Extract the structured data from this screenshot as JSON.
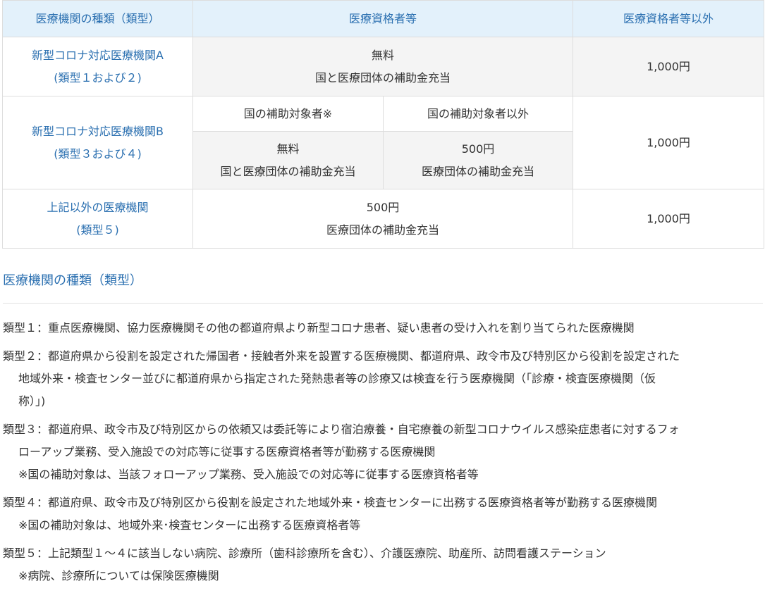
{
  "table": {
    "headers": [
      "医療機関の種類（類型）",
      "医療資格者等",
      "医療資格者等以外"
    ],
    "row_a": {
      "name": [
        "新型コロナ対応医療機関A",
        "(類型１および２)"
      ],
      "qualified": [
        "無料",
        "国と医療団体の補助金充当"
      ],
      "other": "1,000円"
    },
    "row_b": {
      "name": [
        "新型コロナ対応医療機関B",
        "(類型３および４)"
      ],
      "sub_headers": [
        "国の補助対象者※",
        "国の補助対象者以外"
      ],
      "subsidized": [
        "無料",
        "国と医療団体の補助金充当"
      ],
      "non_subsidized": [
        "500円",
        "医療団体の補助金充当"
      ],
      "other": "1,000円"
    },
    "row_c": {
      "name": [
        "上記以外の医療機関",
        "(類型５)"
      ],
      "qualified": [
        "500円",
        "医療団体の補助金充当"
      ],
      "other": "1,000円"
    }
  },
  "section_title": "医療機関の種類（類型）",
  "types": [
    {
      "main": "類型１：重点医療機関、協力医療機関その他の都道府県より新型コロナ患者、疑い患者の受け入れを割り当てられた医療機関",
      "cont": [],
      "notes": []
    },
    {
      "main": "類型２：都道府県から役割を設定された帰国者・接触者外来を設置する医療機関、都道府県、政令市及び特別区から役割を設定された",
      "cont": [
        "地域外来・検査センター並びに都道府県から指定された発熱患者等の診療又は検査を行う医療機関（「診療・検査医療機関（仮",
        "称）」)"
      ],
      "notes": []
    },
    {
      "main": "類型３：都道府県、政令市及び特別区からの依頼又は委託等により宿泊療養・自宅療養の新型コロナウイルス感染症患者に対するフォ",
      "cont": [
        "ローアップ業務、受入施設での対応等に従事する医療資格者等が勤務する医療機関"
      ],
      "notes": [
        "※国の補助対象は、当該フォローアップ業務、受入施設での対応等に従事する医療資格者等"
      ]
    },
    {
      "main": "類型４：都道府県、政令市及び特別区から役割を設定された地域外来・検査センターに出務する医療資格者等が勤務する医療機関",
      "cont": [],
      "notes": [
        "※国の補助対象は、地域外来･検査センターに出務する医療資格者等"
      ]
    },
    {
      "main": "類型５：上記類型１～４に該当しない病院、診療所（歯科診療所を含む）、介護医療院、助産所、訪問看護ステーション",
      "cont": [],
      "notes": [
        "※病院、診療所については保険医療機関"
      ]
    }
  ],
  "colors": {
    "header_bg": "#e3f1fb",
    "accent_blue": "#2a6fb0",
    "shade_bg": "#f4f4f4",
    "border": "#dddddd"
  }
}
